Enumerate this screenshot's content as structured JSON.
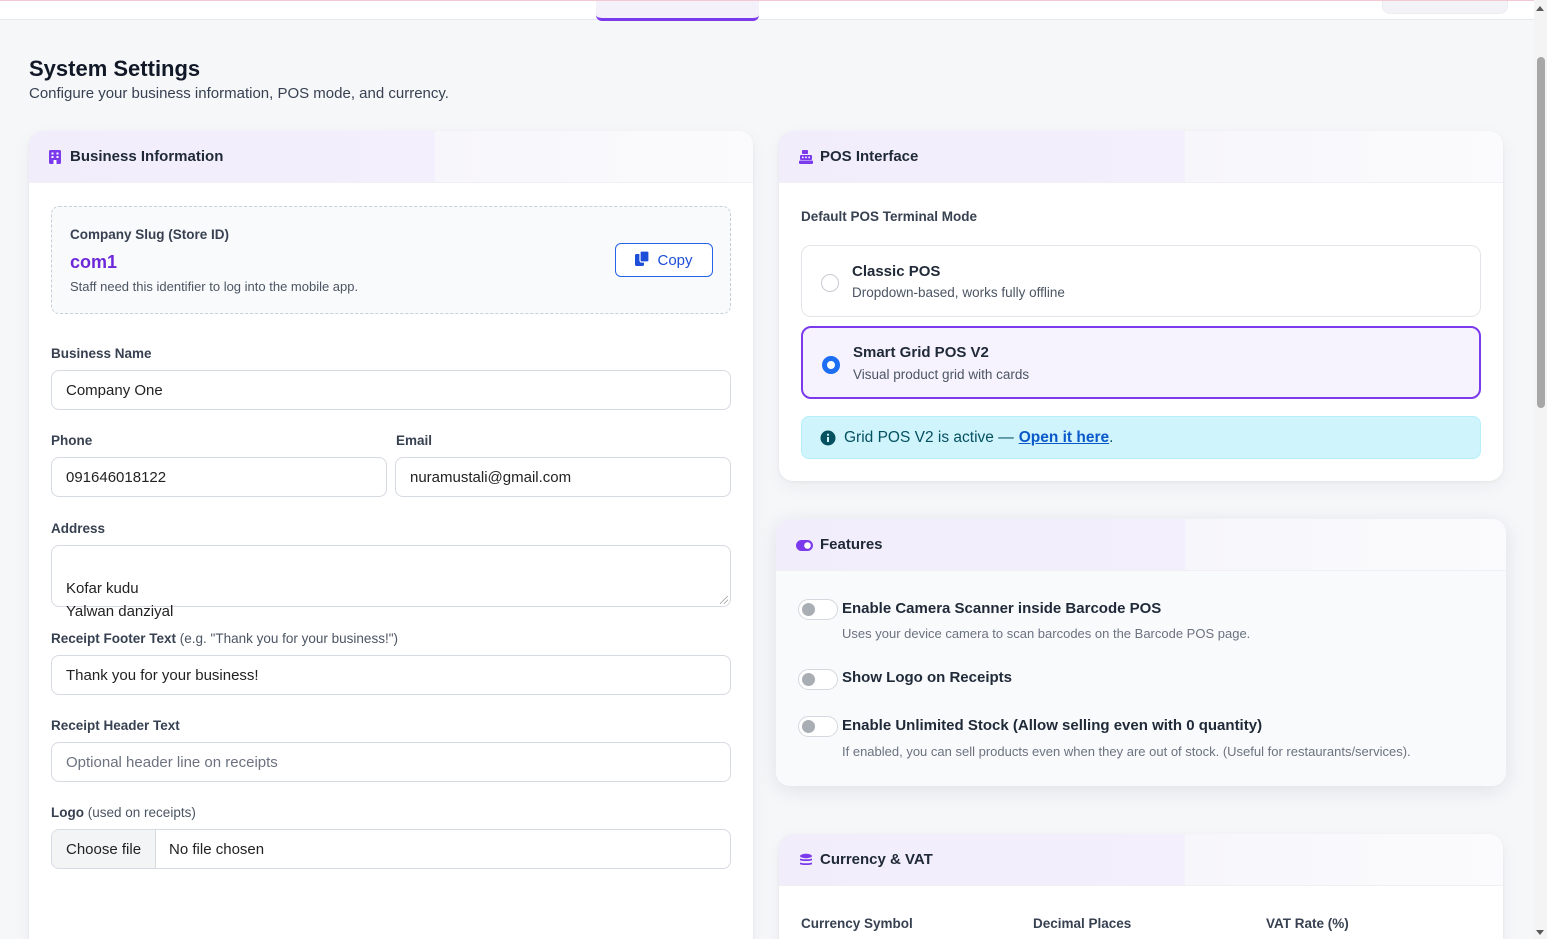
{
  "page": {
    "title": "System Settings",
    "subtitle": "Configure your business information, POS mode, and currency."
  },
  "colors": {
    "accent": "#7c3aed",
    "primary_blue": "#2563eb",
    "info_bg": "#cff4fc"
  },
  "business": {
    "header": "Business Information",
    "header_icon": "building-icon",
    "slug": {
      "label": "Company Slug (Store ID)",
      "value": "com1",
      "help": "Staff need this identifier to log into the mobile app.",
      "copy_label": "Copy",
      "copy_icon": "clipboard-icon"
    },
    "business_name": {
      "label": "Business Name",
      "value": "Company One"
    },
    "phone": {
      "label": "Phone",
      "value": "091646018122"
    },
    "email": {
      "label": "Email",
      "value": "nuramustali@gmail.com"
    },
    "address": {
      "label": "Address",
      "value": "Kofar kudu\nYalwan danziyal"
    },
    "receipt_footer": {
      "label": "Receipt Footer Text",
      "hint": "(e.g. \"Thank you for your business!\")",
      "value": "Thank you for your business!"
    },
    "receipt_header": {
      "label": "Receipt Header Text",
      "placeholder": "Optional header line on receipts"
    },
    "logo": {
      "label": "Logo",
      "hint": "(used on receipts)",
      "button": "Choose file",
      "status": "No file chosen"
    }
  },
  "pos": {
    "header": "POS Interface",
    "header_icon": "cash-register-icon",
    "mode_label": "Default POS Terminal Mode",
    "options": [
      {
        "title": "Classic POS",
        "desc": "Dropdown-based, works fully offline",
        "selected": false
      },
      {
        "title": "Smart Grid POS V2",
        "desc": "Visual product grid with cards",
        "selected": true
      }
    ],
    "alert": {
      "text": "Grid POS V2 is active —",
      "link": "Open it here",
      "suffix": "."
    }
  },
  "features": {
    "header": "Features",
    "header_icon": "toggle-icon",
    "items": [
      {
        "title": "Enable Camera Scanner inside Barcode POS",
        "desc": "Uses your device camera to scan barcodes on the Barcode POS page.",
        "enabled": false
      },
      {
        "title": "Show Logo on Receipts",
        "desc": "",
        "enabled": false
      },
      {
        "title": "Enable Unlimited Stock (Allow selling even with 0 quantity)",
        "desc": "If enabled, you can sell products even when they are out of stock. (Useful for restaurants/services).",
        "enabled": false
      }
    ]
  },
  "currency": {
    "header": "Currency & VAT",
    "header_icon": "coins-icon",
    "labels": [
      "Currency Symbol",
      "Decimal Places",
      "VAT Rate (%)"
    ]
  }
}
